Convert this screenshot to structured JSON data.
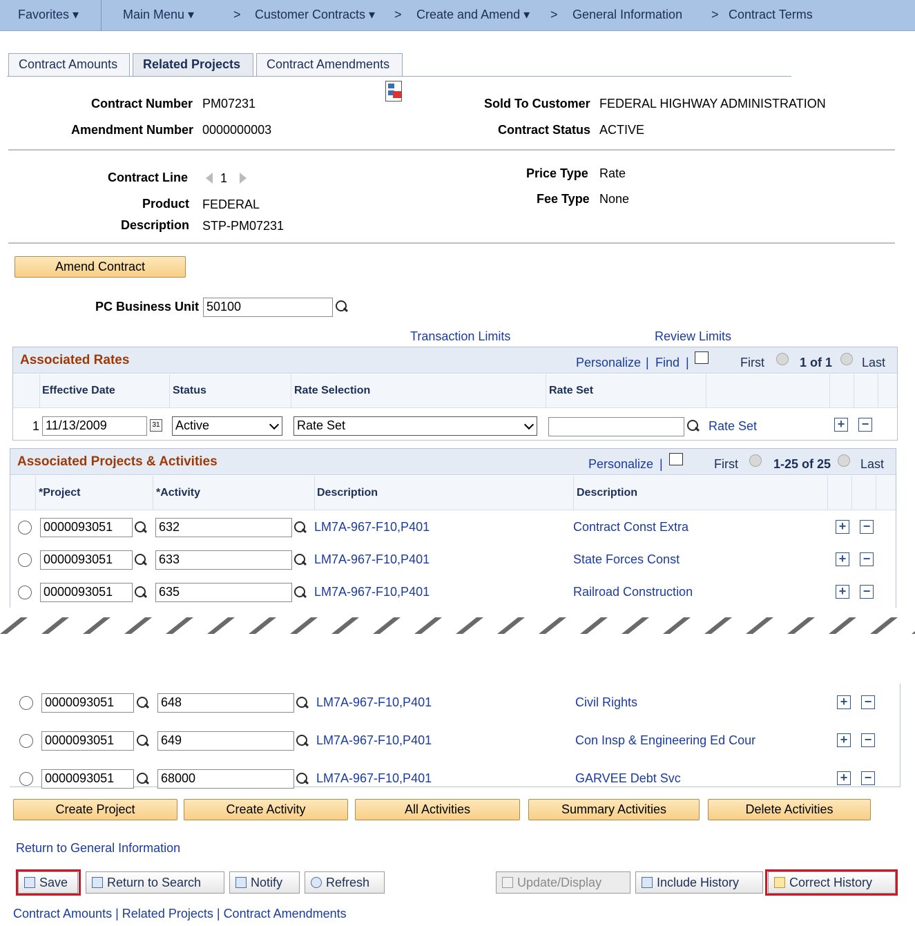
{
  "nav": {
    "favorites": "Favorites ▾",
    "main_menu": "Main Menu ▾",
    "crumbs": [
      {
        "sep": ">",
        "label": "Customer Contracts ▾"
      },
      {
        "sep": ">",
        "label": "Create and Amend ▾"
      },
      {
        "sep": ">",
        "label": "General Information"
      },
      {
        "sep": ">",
        "label": "Contract Terms"
      }
    ]
  },
  "tabs": [
    "Contract Amounts",
    "Related Projects",
    "Contract Amendments"
  ],
  "header": {
    "contract_number_label": "Contract Number",
    "contract_number": "PM07231",
    "amendment_number_label": "Amendment Number",
    "amendment_number": "0000000003",
    "sold_to_label": "Sold To Customer",
    "sold_to": "FEDERAL HIGHWAY ADMINISTRATION",
    "status_label": "Contract Status",
    "status": "ACTIVE"
  },
  "line": {
    "contract_line_label": "Contract Line",
    "contract_line": "1",
    "product_label": "Product",
    "product": "FEDERAL",
    "description_label": "Description",
    "description": "STP-PM07231",
    "price_type_label": "Price Type",
    "price_type": "Rate",
    "fee_type_label": "Fee Type",
    "fee_type": "None"
  },
  "amend_button": "Amend Contract",
  "pc_business_unit_label": "PC Business Unit",
  "pc_business_unit": "50100",
  "transaction_limits": "Transaction Limits",
  "review_limits": "Review Limits",
  "rates": {
    "title": "Associated Rates",
    "personalize": "Personalize",
    "find": "Find",
    "first": "First",
    "range": "1 of 1",
    "last": "Last",
    "columns": [
      "Effective Date",
      "Status",
      "Rate Selection",
      "Rate Set"
    ],
    "row": {
      "num": "1",
      "date": "11/13/2009",
      "status": "Active",
      "selection": "Rate Set",
      "rate_set": "",
      "rate_set_link": "Rate Set"
    }
  },
  "projects": {
    "title": "Associated Projects & Activities",
    "personalize": "Personalize",
    "first": "First",
    "range": "1-25 of 25",
    "last": "Last",
    "columns": [
      "*Project",
      "*Activity",
      "Description",
      "Description"
    ],
    "rows_top": [
      {
        "project": "0000093051",
        "activity": "632",
        "proj_desc": "LM7A-967-F10,P401",
        "act_desc": "Contract Const Extra"
      },
      {
        "project": "0000093051",
        "activity": "633",
        "proj_desc": "LM7A-967-F10,P401",
        "act_desc": "State Forces Const"
      },
      {
        "project": "0000093051",
        "activity": "635",
        "proj_desc": "LM7A-967-F10,P401",
        "act_desc": "Railroad Construction"
      }
    ],
    "rows_bottom": [
      {
        "project": "0000093051",
        "activity": "648",
        "proj_desc": "LM7A-967-F10,P401",
        "act_desc": "Civil Rights"
      },
      {
        "project": "0000093051",
        "activity": "649",
        "proj_desc": "LM7A-967-F10,P401",
        "act_desc": "Con Insp & Engineering Ed Cour"
      },
      {
        "project": "0000093051",
        "activity": "68000",
        "proj_desc": "LM7A-967-F10,P401",
        "act_desc": "GARVEE Debt Svc"
      }
    ]
  },
  "actions": [
    "Create Project",
    "Create Activity",
    "All Activities",
    "Summary Activities",
    "Delete Activities"
  ],
  "return_general": "Return to General Information",
  "toolbar": {
    "save": "Save",
    "return_search": "Return to Search",
    "notify": "Notify",
    "refresh": "Refresh",
    "update_display": "Update/Display",
    "include_history": "Include History",
    "correct_history": "Correct History"
  },
  "footer_links": [
    "Contract Amounts",
    "Related Projects",
    "Contract Amendments"
  ],
  "colors": {
    "highlight": "#c81a2a",
    "nav_bg": "#a9c3e4",
    "grid_title": "#9c3a08"
  }
}
